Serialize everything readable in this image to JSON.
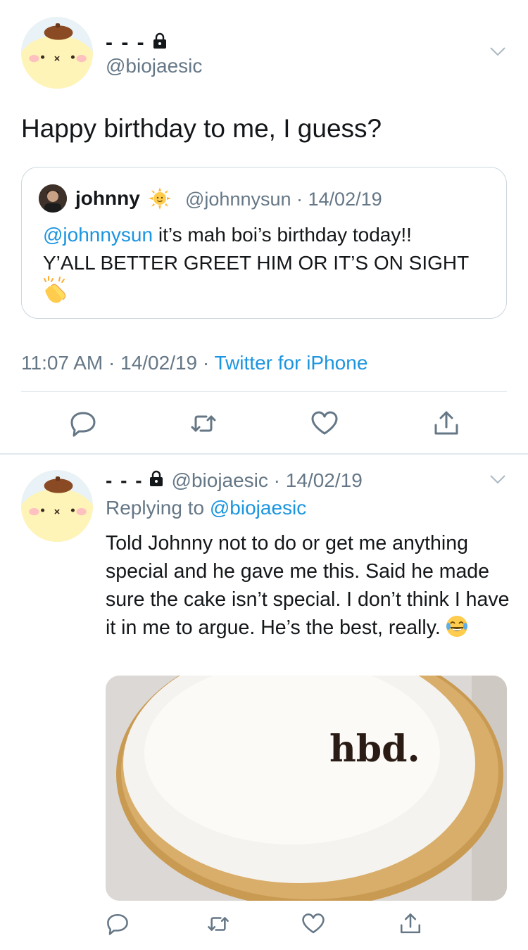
{
  "tweet1": {
    "display_name": "- - -",
    "handle": "@biojaesic",
    "text": "Happy birthday to me, I guess?",
    "quote": {
      "name": "johnny",
      "handle": "@johnnysun",
      "date": "14/02/19",
      "mention": "@johnnysun",
      "body_line1": " it’s mah boi’s birthday today!!",
      "body_line2": "Y’ALL BETTER GREET HIM OR IT’S ON SIGHT"
    },
    "time": "11:07 AM",
    "date": "14/02/19",
    "source": "Twitter for iPhone"
  },
  "tweet2": {
    "display_name": "- - -",
    "handle": "@biojaesic",
    "date": "14/02/19",
    "replying_prefix": "Replying to ",
    "replying_to": "@biojaesic",
    "body": "Told Johnny not to do or get me anything special and he gave me this. Said he made sure  the cake isn’t special. I don’t think I have it in me to argue. He’s the best, really.",
    "photo_text": "hbd."
  },
  "colors": {
    "link": "#1b95e0",
    "secondary": "#657786",
    "border": "#e1e8ed"
  },
  "icons": [
    "lock-icon",
    "chevron-down-icon",
    "reply-icon",
    "retweet-icon",
    "like-icon",
    "share-icon",
    "sun-emoji-icon",
    "clap-emoji-icon",
    "laugh-emoji-icon"
  ]
}
